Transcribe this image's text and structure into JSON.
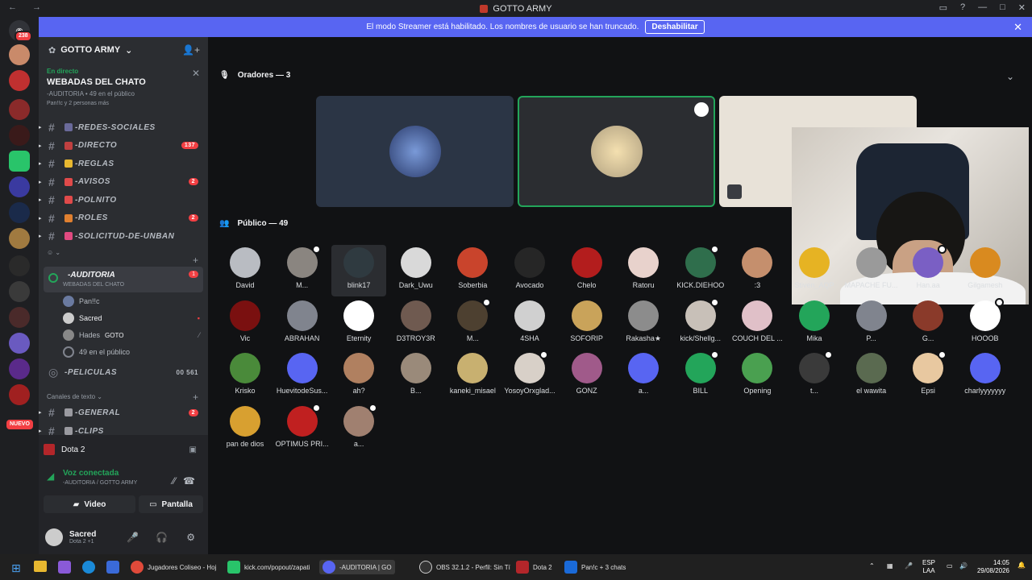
{
  "window": {
    "title": "GOTTO ARMY",
    "nav": "← →"
  },
  "notice": {
    "text": "El modo Streamer está habilitado. Los nombres de usuario se han truncado.",
    "button": "Deshabilitar"
  },
  "guilds": {
    "mentions": "238",
    "new_label": "NUEVO"
  },
  "server": {
    "name": "GOTTO ARMY"
  },
  "live": {
    "status": "En directo",
    "title": "WEBADAS DEL CHATO",
    "stage": "-AUDITORIA",
    "audience": "49 en el público",
    "speakers": "Pan!!c y 2 personas más"
  },
  "channels": [
    {
      "name": "-REDES-SOCIALES",
      "badge": ""
    },
    {
      "name": "-DIRECTO",
      "badge": "137"
    },
    {
      "name": "-REGLAS",
      "badge": ""
    },
    {
      "name": "-AVISOS",
      "badge": "2"
    },
    {
      "name": "-POLNITO",
      "badge": ""
    },
    {
      "name": "-ROLES",
      "badge": "2"
    },
    {
      "name": "-SOLICITUD-DE-UNBAN",
      "badge": ""
    }
  ],
  "stage_channel": {
    "name": "-AUDITORIA",
    "subtitle": "WEBADAS DEL CHATO",
    "badge": "1"
  },
  "stage_users": [
    {
      "name": "Pan!!c"
    },
    {
      "name": "Sacred"
    },
    {
      "name": "Hades",
      "tag": "GOTO"
    },
    {
      "name": "49 en el público"
    }
  ],
  "peliculas": {
    "name": "-PELICULAS",
    "count_a": "00",
    "count_b": "561"
  },
  "text_category": "Canales de texto",
  "text_channels": [
    {
      "name": "-GENERAL",
      "badge": "2"
    },
    {
      "name": "-CLIPS",
      "badge": ""
    }
  ],
  "voice_panel": {
    "game": "Dota 2",
    "status": "Voz conectada",
    "location": "-AUDITORIA / GOTTO ARMY",
    "video": "Video",
    "screen": "Pantalla"
  },
  "user": {
    "name": "Sacred",
    "activity": "Dota 2 +1"
  },
  "stage": {
    "speakers_label": "Oradores — 3",
    "audience_label": "Público — 49"
  },
  "members": [
    {
      "name": "David",
      "color": "#b9bcc2"
    },
    {
      "name": "M...",
      "color": "#8a8580"
    },
    {
      "name": "blink17",
      "color": "#2f3a40"
    },
    {
      "name": "Dark_Uwu",
      "color": "#d9d9d9"
    },
    {
      "name": "Soberbia",
      "color": "#c9442c"
    },
    {
      "name": "Avocado",
      "color": "#262626"
    },
    {
      "name": "Chelo",
      "color": "#b31d1d"
    },
    {
      "name": "Ratoru",
      "color": "#e8d2cc"
    },
    {
      "name": "KICK.DIEHOO",
      "color": "#2f6e4c"
    },
    {
      "name": ":3",
      "color": "#c58f6d"
    },
    {
      "name": "Stiven_AQP",
      "color": "#e6b323"
    },
    {
      "name": "MAPACHE FU...",
      "color": "#9a9a9a"
    },
    {
      "name": "Han.aa",
      "color": "#7a5fc4"
    },
    {
      "name": "Gilgamesh",
      "color": "#d98a1f"
    },
    {
      "name": "Vic",
      "color": "#7a1010"
    },
    {
      "name": "ABRAHAN",
      "color": "#80848e"
    },
    {
      "name": "Eternity",
      "color": "#ffffff"
    },
    {
      "name": "D3TROY3R",
      "color": "#6f5a50"
    },
    {
      "name": "M...",
      "color": "#4d4030"
    },
    {
      "name": "4SHA",
      "color": "#d0d0d0"
    },
    {
      "name": "SOFORIP",
      "color": "#c9a35a"
    },
    {
      "name": "Rakasha★",
      "color": "#8c8c8c"
    },
    {
      "name": "kick/Shellg...",
      "color": "#c8c0b8"
    },
    {
      "name": "COUCH DEL ...",
      "color": "#e0c0c8"
    },
    {
      "name": "Mika",
      "color": "#23a55a"
    },
    {
      "name": "P...",
      "color": "#80848e"
    },
    {
      "name": "G...",
      "color": "#8a3a2a"
    },
    {
      "name": "HOOOB",
      "color": "#ffffff"
    },
    {
      "name": "Krisko",
      "color": "#4a8a3a"
    },
    {
      "name": "HuevitodeSus...",
      "color": "#5865f2"
    },
    {
      "name": "ah?",
      "color": "#b08060"
    },
    {
      "name": "B...",
      "color": "#9a8a7a"
    },
    {
      "name": "kaneki_misael",
      "color": "#c8b070"
    },
    {
      "name": "YosoyOrxglad...",
      "color": "#d8d0c8"
    },
    {
      "name": "GONZ",
      "color": "#a05a8a"
    },
    {
      "name": "a...",
      "color": "#5865f2"
    },
    {
      "name": "BILL",
      "color": "#23a55a"
    },
    {
      "name": "Opening",
      "color": "#4aa050"
    },
    {
      "name": "t...",
      "color": "#3a3a3a"
    },
    {
      "name": "el wawita",
      "color": "#5a6a50"
    },
    {
      "name": "Epsi",
      "color": "#e8c8a0"
    },
    {
      "name": "charlyyyyyyy",
      "color": "#5865f2"
    },
    {
      "name": "pan de dios",
      "color": "#d8a030"
    },
    {
      "name": "OPTIMUS PRI...",
      "color": "#c02020"
    },
    {
      "name": "a...",
      "color": "#a08070"
    }
  ],
  "taskbar": {
    "items": [
      "Jugadores Coliseo - Hoj",
      "kick.com/popout/zapati",
      "-AUDITORIA | GO",
      "OBS 32.1.2 - Perfil: Sin Tí",
      "Dota 2",
      "Pan!c + 3 chats"
    ],
    "lang": "ESP",
    "region": "LAA",
    "time": "14:05",
    "date": "29/08/2026"
  }
}
